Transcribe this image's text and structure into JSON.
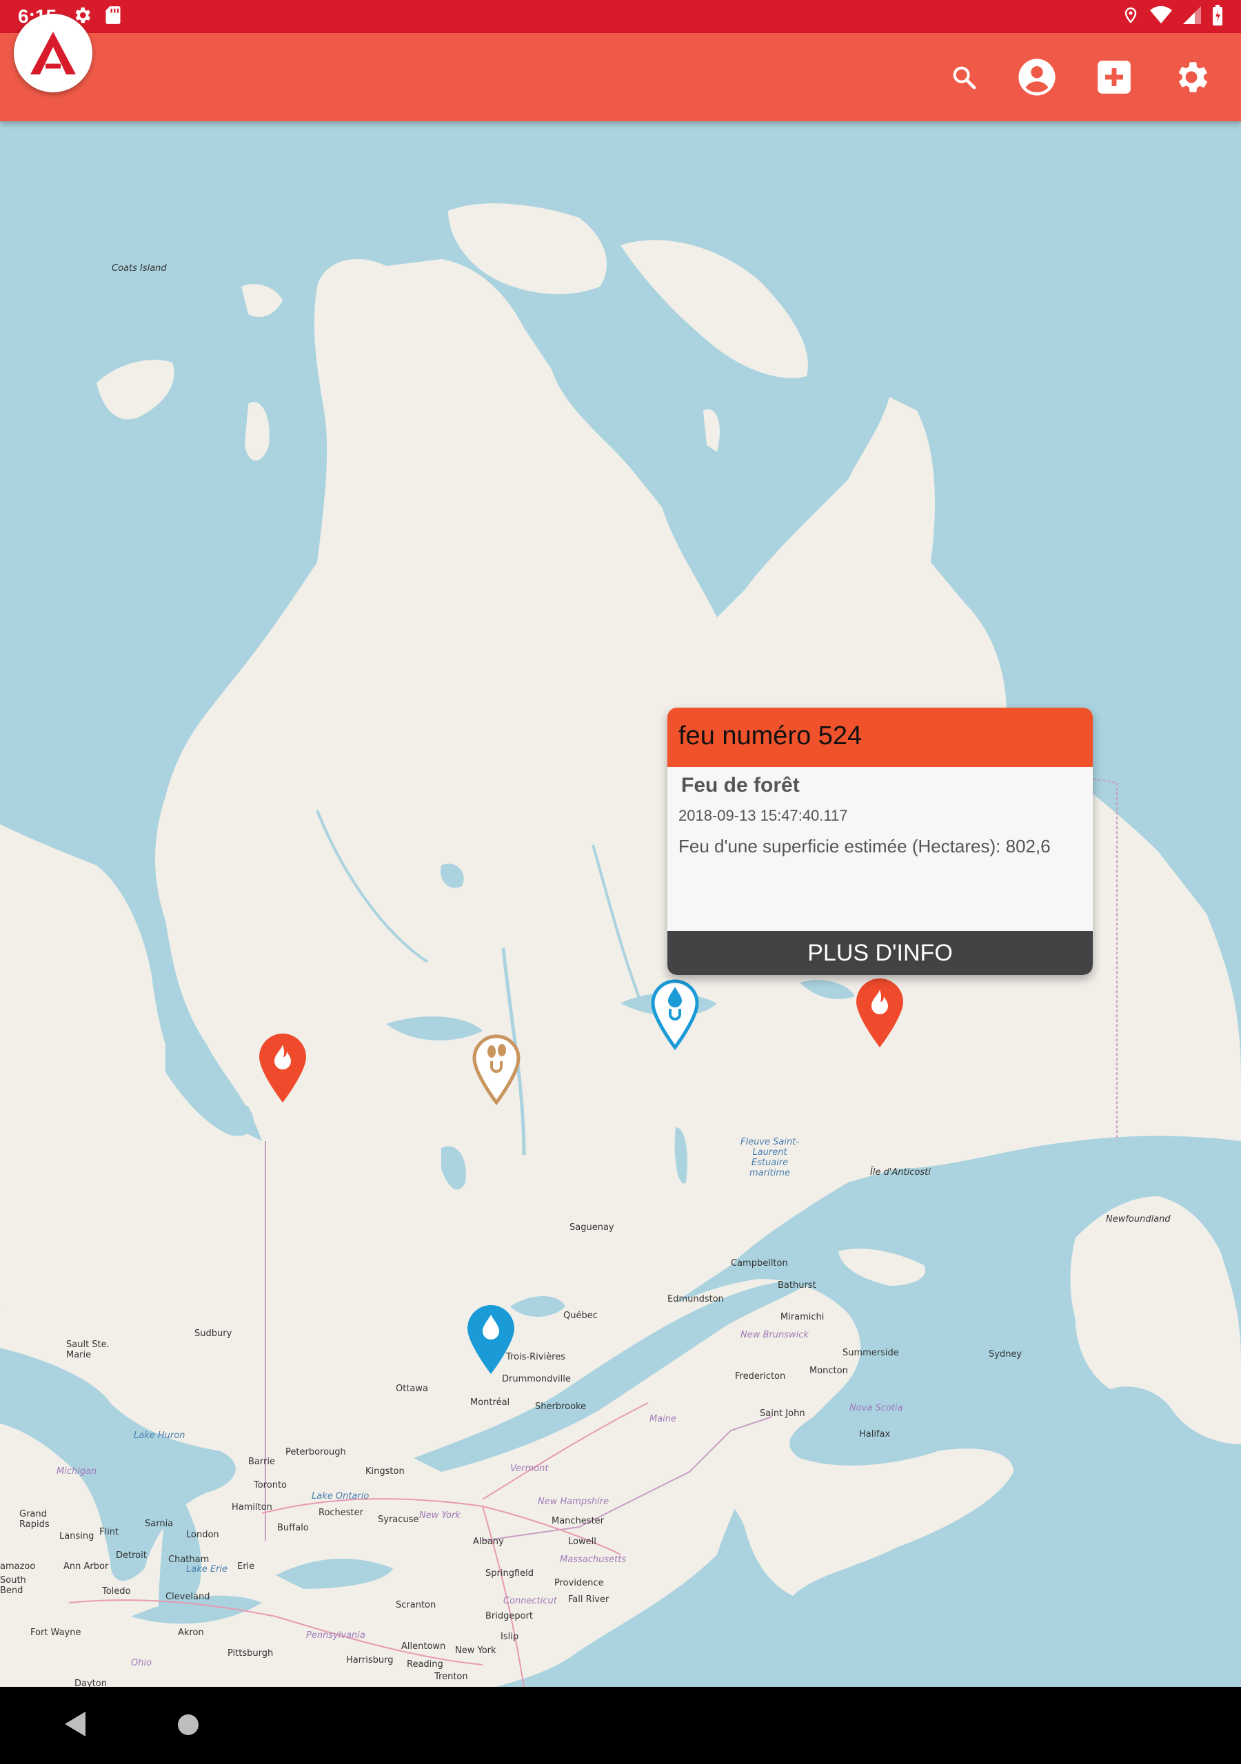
{
  "status_bar": {
    "time": "6:15",
    "left_icons": [
      "settings-icon",
      "sd-card-icon"
    ],
    "right_icons": [
      "location-icon",
      "wifi-icon",
      "signal-icon",
      "battery-icon"
    ]
  },
  "app_bar": {
    "logo_icon": "app-logo",
    "actions": [
      "search-icon",
      "account-icon",
      "add-box-icon",
      "settings-icon"
    ]
  },
  "map": {
    "places": {
      "coats_island": "Coats Island",
      "saguenay": "Saguenay",
      "quebec": "Québec",
      "trois_rivieres": "Trois-Rivières",
      "drummondville": "Drummondville",
      "montreal": "Montréal",
      "sherbrooke": "Sherbrooke",
      "ottawa": "Ottawa",
      "sudbury": "Sudbury",
      "sault_ste_marie": "Sault Ste.\nMarie",
      "lake_huron": "Lake Huron",
      "michigan": "Michigan",
      "peterborough": "Peterborough",
      "barrie": "Barrie",
      "toronto": "Toronto",
      "kingston": "Kingston",
      "lake_ontario": "Lake Ontario",
      "hamilton": "Hamilton",
      "rochester": "Rochester",
      "syracuse": "Syracuse",
      "new_york_state": "New York",
      "buffalo": "Buffalo",
      "london": "London",
      "sarnia": "Sarnia",
      "flint": "Flint",
      "lansing": "Lansing",
      "grand_rapids": "Grand\nRapids",
      "detroit": "Detroit",
      "chatham": "Chatham",
      "lake_erie": "Lake Erie",
      "erie": "Erie",
      "ann_arbor": "Ann Arbor",
      "kalamazoo": "amazoo",
      "south_bend": "South\nBend",
      "toledo": "Toledo",
      "cleveland": "Cleveland",
      "fort_wayne": "Fort Wayne",
      "akron": "Akron",
      "pittsburgh": "Pittsburgh",
      "pennsylvania": "Pennsylvania",
      "ohio": "Ohio",
      "dayton": "Dayton",
      "harrisburg": "Harrisburg",
      "allentown": "Allentown",
      "reading": "Reading",
      "trenton": "Trenton",
      "new_york_city": "New York",
      "islip": "Islip",
      "bridgeport": "Bridgeport",
      "scranton": "Scranton",
      "albany": "Albany",
      "vermont": "Vermont",
      "new_hampshire": "New Hampshire",
      "manchester": "Manchester",
      "lowell": "Lowell",
      "massachusetts": "Massachusetts",
      "springfield": "Springfield",
      "connecticut": "Connecticut",
      "providence": "Providence",
      "fall_river": "Fall River",
      "maine": "Maine",
      "saint_john": "Saint John",
      "fredericton": "Fredericton",
      "moncton": "Moncton",
      "new_brunswick": "New Brunswick",
      "miramichi": "Miramichi",
      "bathurst": "Bathurst",
      "campbellton": "Campbellton",
      "edmundston": "Edmundston",
      "summerside": "Summerside",
      "sydney": "Sydney",
      "nova_scotia": "Nova Scotia",
      "halifax": "Halifax",
      "ile_anticosti": "Île d'Anticosti",
      "fleuve": "Fleuve Saint-\nLaurent\nEstuaire\nmaritime",
      "newfoundland": "Newfoundland"
    },
    "markers": [
      {
        "type": "fire",
        "color": "#ef4a2b"
      },
      {
        "type": "fire",
        "color": "#ef4a2b"
      },
      {
        "type": "footprints",
        "color": "#c9955f"
      },
      {
        "type": "water-u",
        "color": "#1a9ad6"
      },
      {
        "type": "water",
        "color": "#1a9ad6"
      }
    ]
  },
  "popup": {
    "title": "feu numéro 524",
    "subtitle": "Feu de forêt",
    "datetime": "2018-09-13 15:47:40.117",
    "description": "Feu d'une superficie estimée (Hectares): 802,6",
    "button": "PLUS D'INFO",
    "header_color": "#f0532b"
  },
  "nav_bar": {
    "buttons": [
      "back-icon",
      "home-icon"
    ]
  },
  "colors": {
    "status_bar": "#d81b2a",
    "app_bar": "#ef5a48",
    "water": "#aad3df",
    "land": "#f2efe9"
  }
}
